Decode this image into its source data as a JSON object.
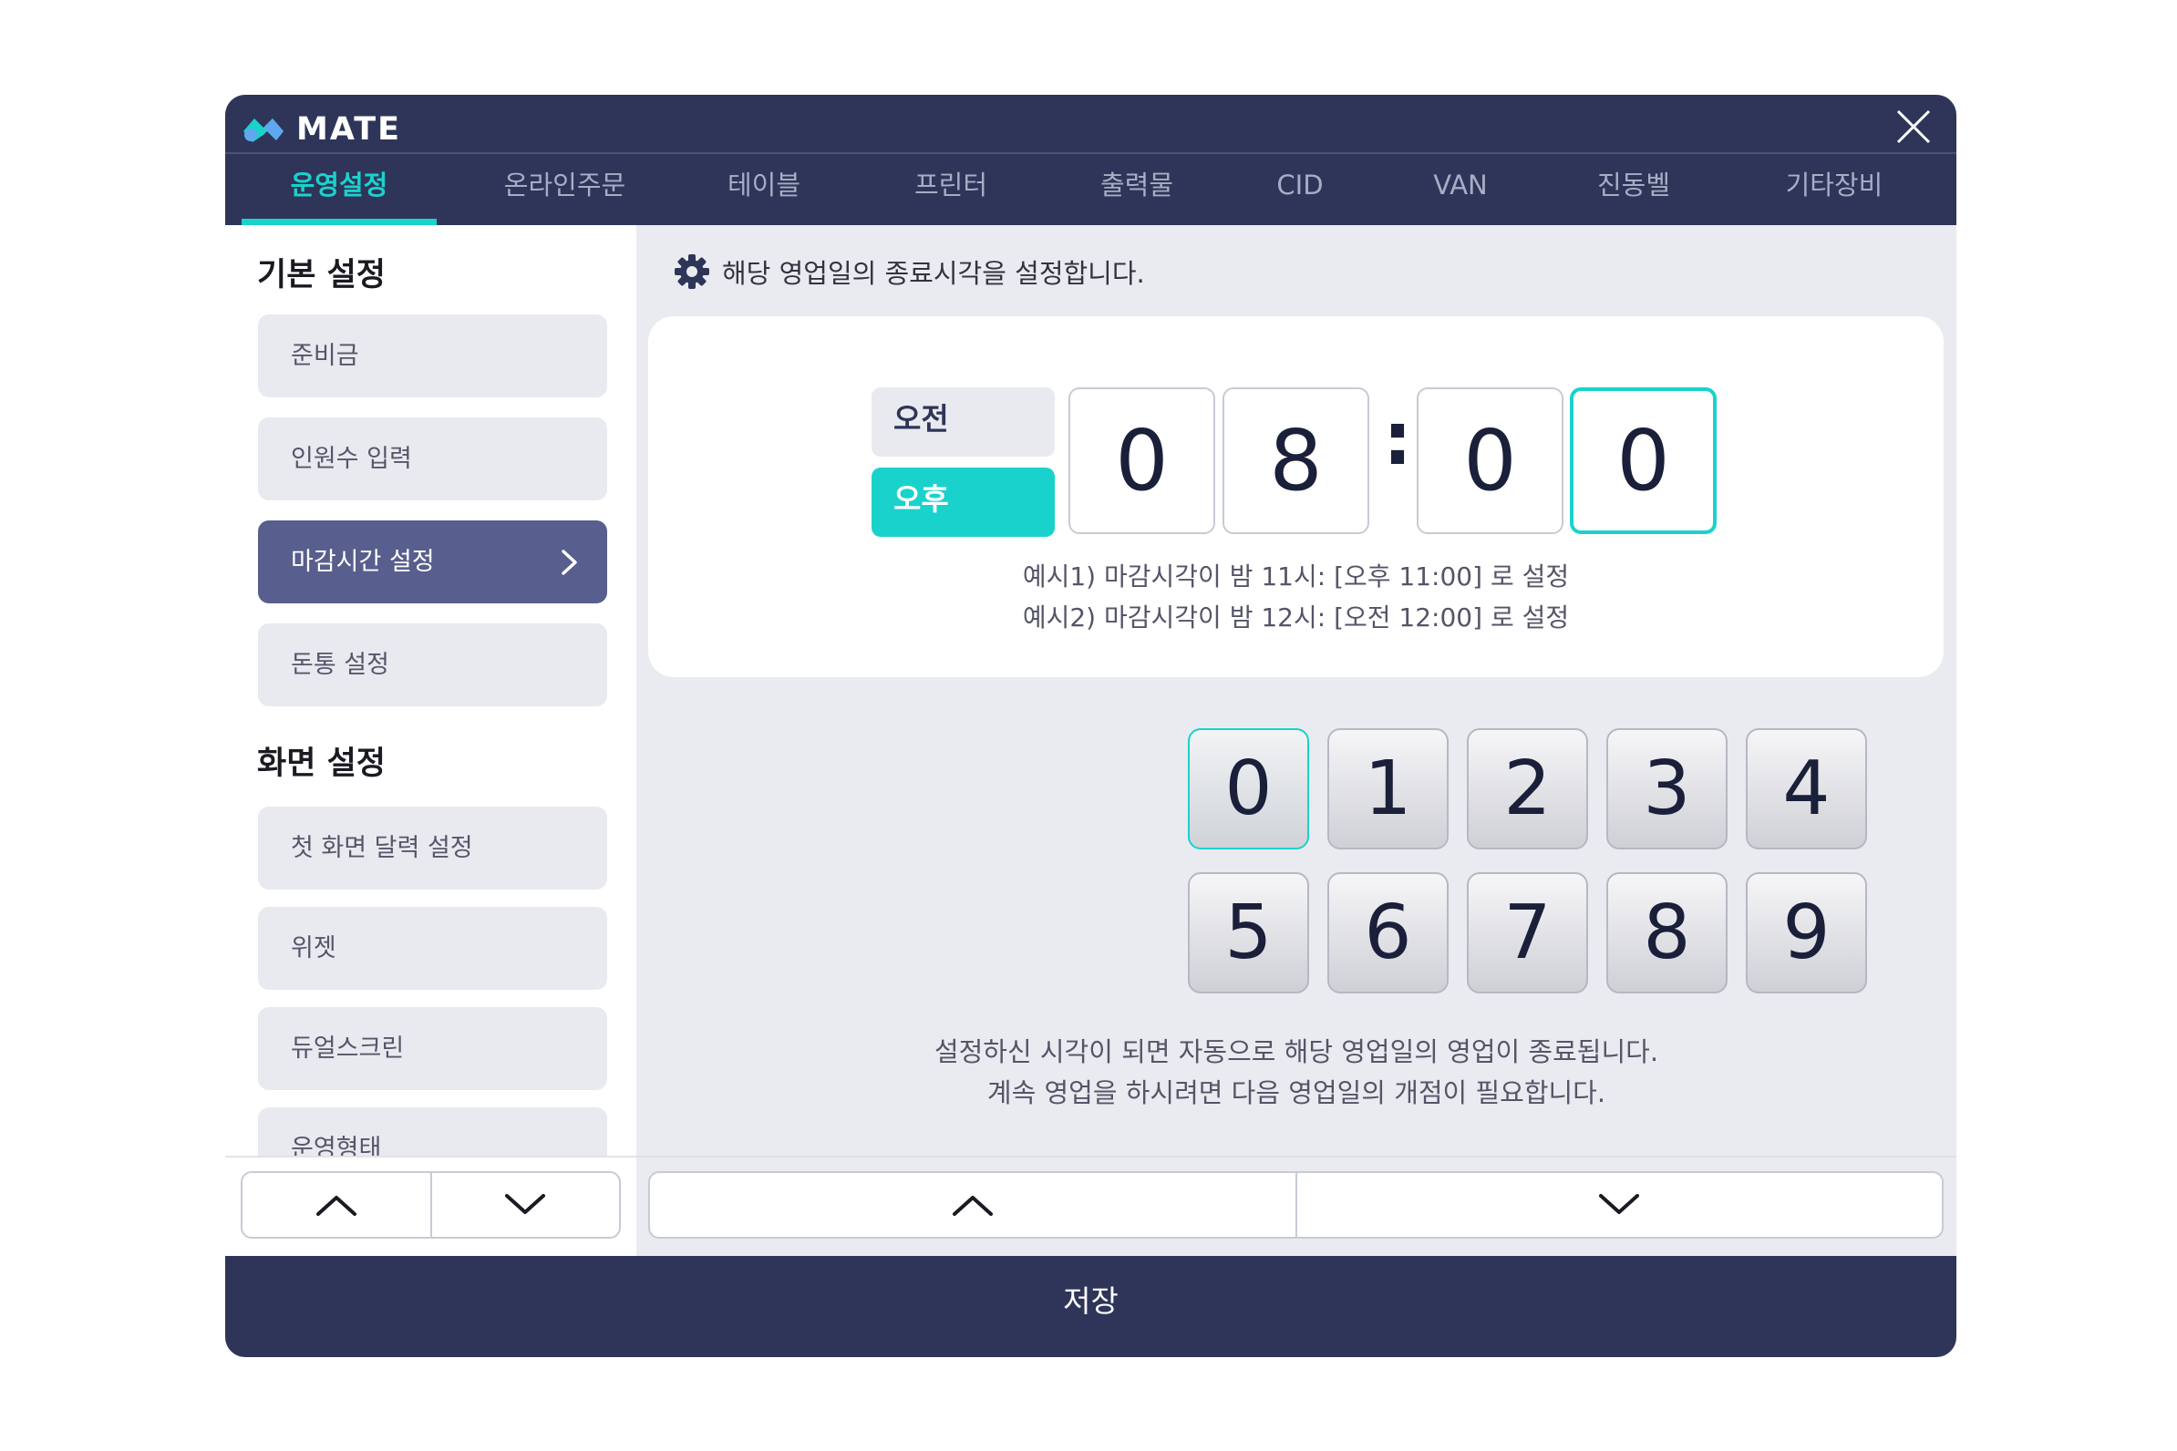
{
  "app": {
    "logo_text": "MATE",
    "brand_color": "#1ad2cc",
    "header_color": "#2e3558"
  },
  "tabs": [
    {
      "label": "운영설정",
      "active": true
    },
    {
      "label": "온라인주문"
    },
    {
      "label": "테이블"
    },
    {
      "label": "프린터"
    },
    {
      "label": "출력물"
    },
    {
      "label": "CID"
    },
    {
      "label": "VAN"
    },
    {
      "label": "진동벨"
    },
    {
      "label": "기타장비"
    }
  ],
  "sidebar": {
    "sections": [
      {
        "title": "기본 설정",
        "items": [
          {
            "label": "준비금"
          },
          {
            "label": "인원수 입력"
          },
          {
            "label": "마감시간 설정",
            "active": true
          },
          {
            "label": "돈통 설정"
          }
        ]
      },
      {
        "title": "화면 설정",
        "items": [
          {
            "label": "첫 화면 달력 설정"
          },
          {
            "label": "위젯"
          },
          {
            "label": "듀얼스크린"
          },
          {
            "label": "운영형태"
          }
        ]
      }
    ]
  },
  "main": {
    "notice": "해당 영업일의 종료시각을 설정합니다.",
    "time": {
      "am_label": "오전",
      "pm_label": "오후",
      "selected_period": "오후",
      "digits": [
        "0",
        "8",
        "0",
        "0"
      ],
      "separator": ":"
    },
    "examples": [
      "예시1) 마감시각이 밤 11시: [오후 11:00] 로 설정",
      "예시2) 마감시각이 밤 12시: [오전 12:00] 로 설정"
    ],
    "keypad": [
      "0",
      "1",
      "2",
      "3",
      "4",
      "5",
      "6",
      "7",
      "8",
      "9"
    ],
    "info": [
      "설정하신 시각이 되면 자동으로 해당 영업일의 영업이 종료됩니다.",
      "계속 영업을 하시려면 다음 영업일의 개점이 필요합니다."
    ]
  },
  "footer": {
    "save_label": "저장"
  }
}
